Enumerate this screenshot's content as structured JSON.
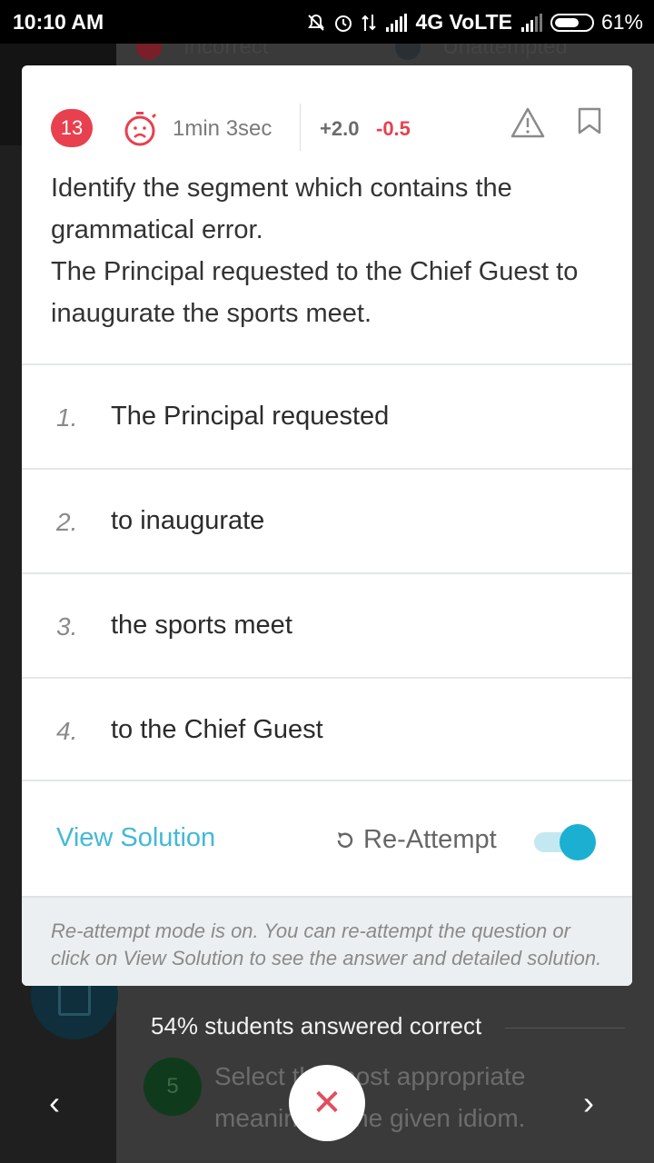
{
  "status_bar": {
    "time": "10:10 AM",
    "network": "4G VoLTE",
    "battery": "61%"
  },
  "background": {
    "legend_left": "Incorrect",
    "legend_right": "Unattempted",
    "stat": "54% students answered correct",
    "next_question_number": "5",
    "next_question_text": "Select the most appropriate meaning of the given idiom."
  },
  "question": {
    "number": "13",
    "time_taken": "1min 3sec",
    "marks_positive": "+2.0",
    "marks_negative": "-0.5",
    "line1": "Identify the segment which contains the grammatical error.",
    "line2": "The Principal requested to the Chief Guest to inaugurate the sports meet."
  },
  "options": [
    {
      "num": "1.",
      "text": "The Principal requested"
    },
    {
      "num": "2.",
      "text": "to inaugurate"
    },
    {
      "num": "3.",
      "text": "the sports meet"
    },
    {
      "num": "4.",
      "text": "to the Chief Guest"
    }
  ],
  "actions": {
    "view_solution": "View Solution",
    "reattempt": "Re-Attempt",
    "reattempt_on": true
  },
  "info_text": "Re-attempt mode is on. You can re-attempt the question or click on View Solution to see the answer and detailed solution.",
  "colors": {
    "accent": "#1bb0d2",
    "error": "#e8404e",
    "link": "#42b9d6"
  }
}
